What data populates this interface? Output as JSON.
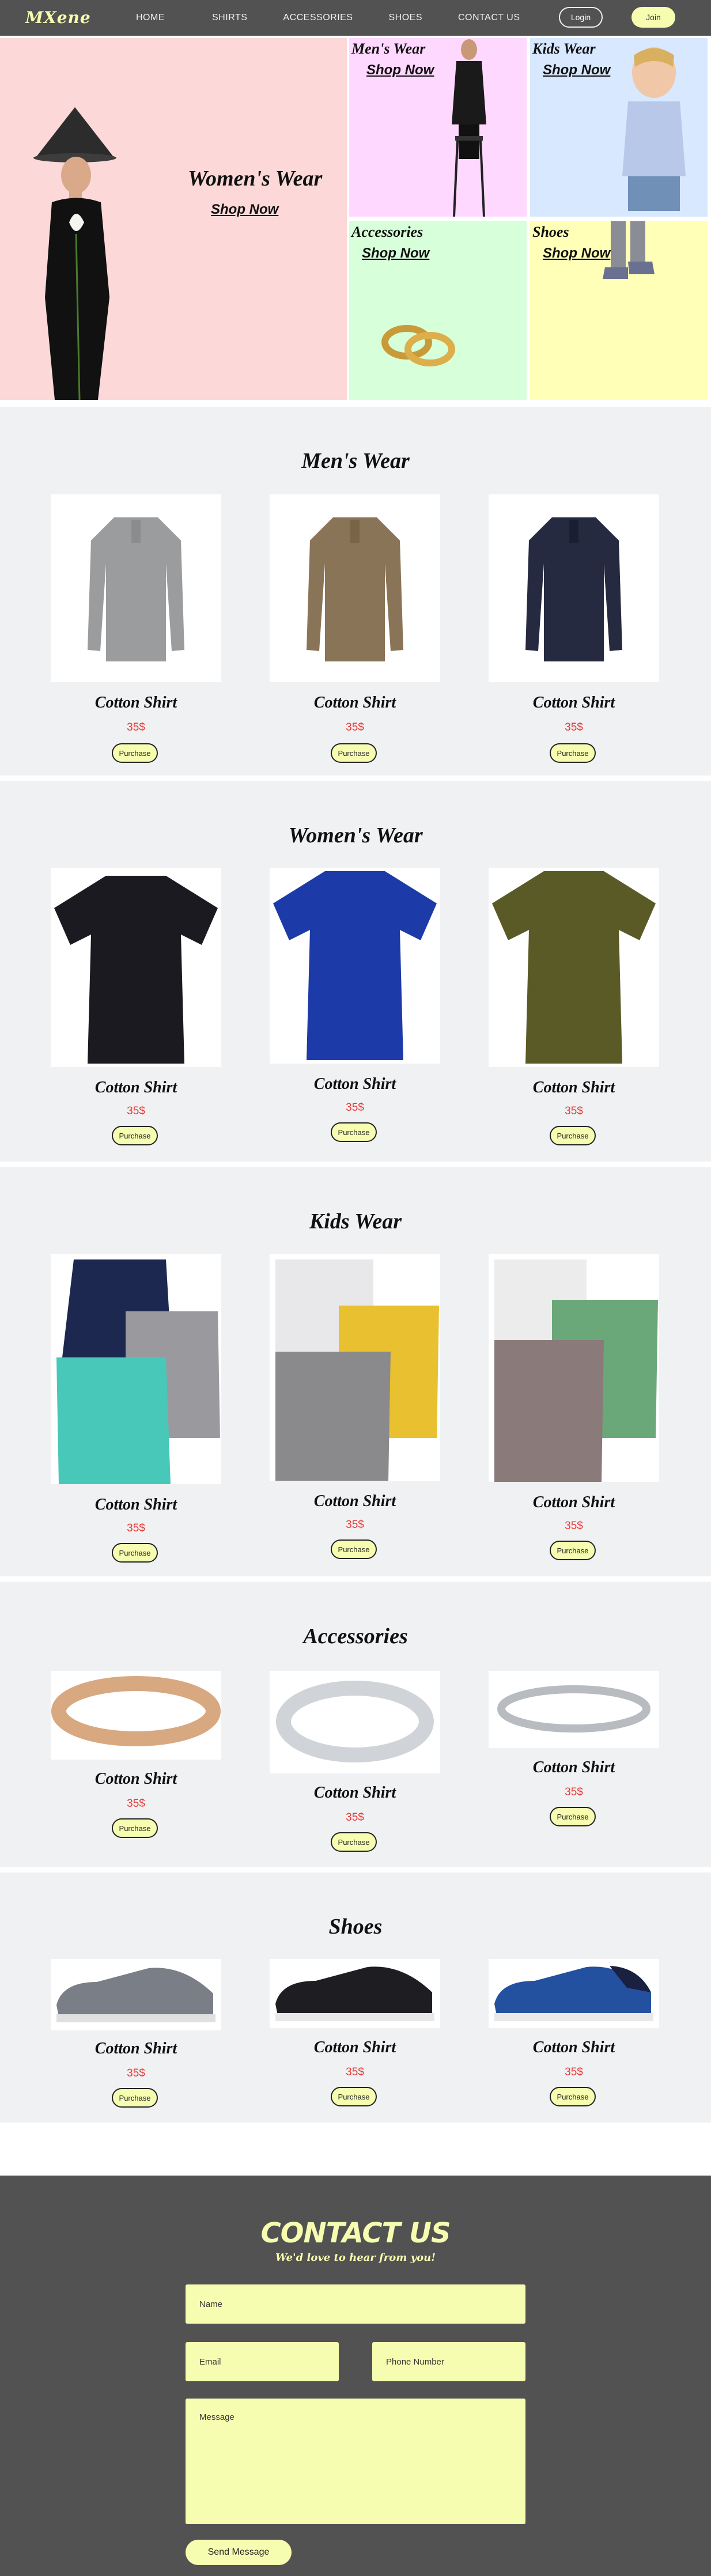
{
  "nav": {
    "logo": "MXene",
    "links": [
      "HOME",
      "SHIRTS",
      "ACCESSORIES",
      "SHOES",
      "CONTACT US"
    ],
    "login": "Login",
    "join": "Join"
  },
  "hero": {
    "main": {
      "title": "Women's Wear",
      "link": "Shop Now"
    },
    "tiles": [
      {
        "title": "Men's Wear",
        "link": "Shop Now",
        "color": "#ffd8ff"
      },
      {
        "title": "Kids Wear",
        "link": "Shop Now",
        "color": "#d8e8ff"
      },
      {
        "title": "Accessories",
        "link": "Shop Now",
        "color": "#d7ffd9"
      },
      {
        "title": "Shoes",
        "link": "Shop Now",
        "color": "#ffffb8"
      }
    ],
    "main_color": "#fcd8d8"
  },
  "sections": [
    {
      "title": "Men's Wear",
      "products": [
        {
          "name": "Cotton Shirt",
          "price": "35$",
          "button": "Purchase"
        },
        {
          "name": "Cotton Shirt",
          "price": "35$",
          "button": "Purchase"
        },
        {
          "name": "Cotton Shirt",
          "price": "35$",
          "button": "Purchase"
        }
      ]
    },
    {
      "title": "Women's Wear",
      "products": [
        {
          "name": "Cotton Shirt",
          "price": "35$",
          "button": "Purchase"
        },
        {
          "name": "Cotton Shirt",
          "price": "35$",
          "button": "Purchase"
        },
        {
          "name": "Cotton Shirt",
          "price": "35$",
          "button": "Purchase"
        }
      ]
    },
    {
      "title": "Kids Wear",
      "products": [
        {
          "name": "Cotton Shirt",
          "price": "35$",
          "button": "Purchase"
        },
        {
          "name": "Cotton Shirt",
          "price": "35$",
          "button": "Purchase"
        },
        {
          "name": "Cotton Shirt",
          "price": "35$",
          "button": "Purchase"
        }
      ]
    },
    {
      "title": "Accessories",
      "products": [
        {
          "name": "Cotton Shirt",
          "price": "35$",
          "button": "Purchase"
        },
        {
          "name": "Cotton Shirt",
          "price": "35$",
          "button": "Purchase"
        },
        {
          "name": "Cotton Shirt",
          "price": "35$",
          "button": "Purchase"
        }
      ]
    },
    {
      "title": "Shoes",
      "products": [
        {
          "name": "Cotton Shirt",
          "price": "35$",
          "button": "Purchase"
        },
        {
          "name": "Cotton Shirt",
          "price": "35$",
          "button": "Purchase"
        },
        {
          "name": "Cotton Shirt",
          "price": "35$",
          "button": "Purchase"
        }
      ]
    }
  ],
  "contact": {
    "title": "CONTACT US",
    "subtitle": "We'd love to hear from you!",
    "name_placeholder": "Name",
    "email_placeholder": "Email",
    "phone_placeholder": "Phone Number",
    "message_placeholder": "Message",
    "send": "Send Message"
  },
  "colors": {
    "accent": "#f7fdb0",
    "dark": "#525252",
    "price": "#e53935",
    "section_bg": "#f0f1f3"
  }
}
